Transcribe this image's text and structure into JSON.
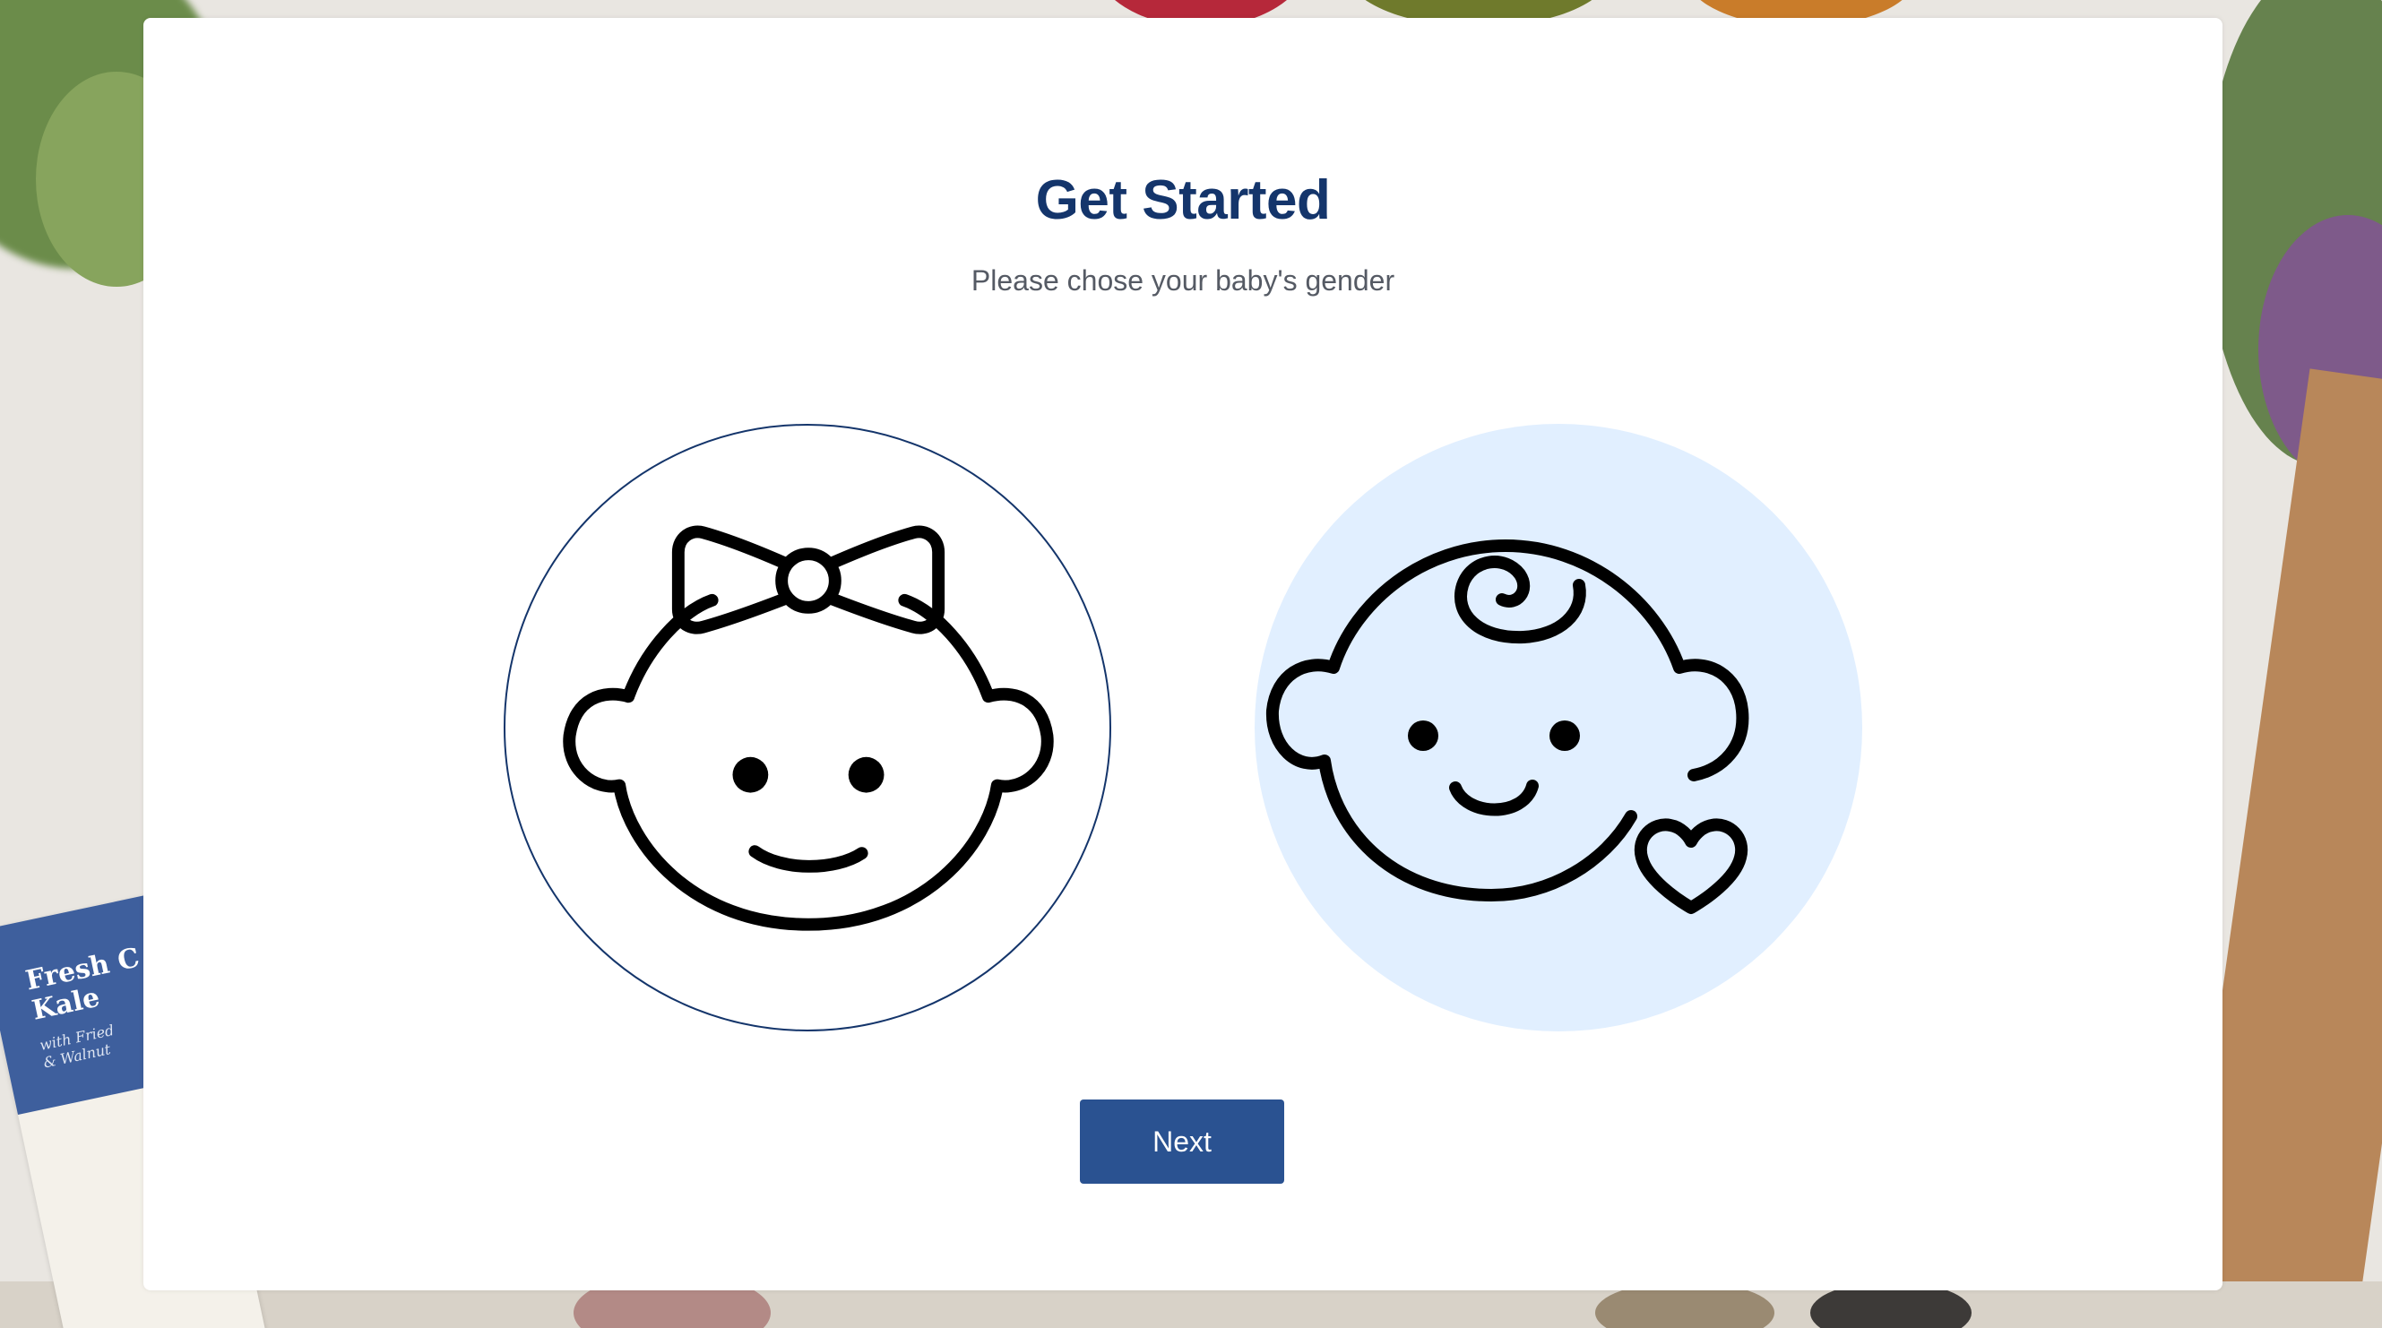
{
  "background": {
    "recipe_card": {
      "title": "Fresh C\nKale",
      "subtitle": "with Fried\n& Walnut"
    }
  },
  "modal": {
    "title": "Get Started",
    "subtitle": "Please chose your baby's gender",
    "options": [
      {
        "icon": "baby-girl-icon",
        "selected": true
      },
      {
        "icon": "baby-boy-icon",
        "selected": false
      }
    ],
    "next_label": "Next"
  },
  "colors": {
    "title": "#14356b",
    "button": "#2a5291",
    "selected_border": "#14356b",
    "unselected_fill": "#e1efff"
  }
}
